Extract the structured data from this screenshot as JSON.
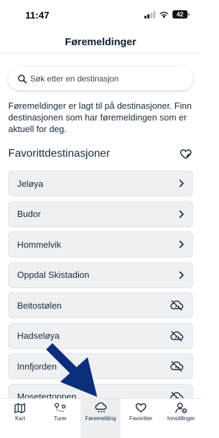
{
  "status_bar": {
    "time": "11:47",
    "battery": "42"
  },
  "header": {
    "title": "Føremeldinger"
  },
  "search": {
    "placeholder": "Søk etter en destinasjon"
  },
  "intro_text": "Føremeldinger er lagt til på destinasjoner. Finn destinasjonen som har føremeldingen som er aktuell for deg.",
  "favorites": {
    "title": "Favorittdestinasjoner",
    "items": [
      {
        "label": "Jeløya",
        "icon": "chevron-right-icon"
      },
      {
        "label": "Budor",
        "icon": "chevron-right-icon"
      },
      {
        "label": "Hommelvik",
        "icon": "chevron-right-icon"
      },
      {
        "label": "Oppdal Skistadion",
        "icon": "chevron-right-icon"
      },
      {
        "label": "Beitostølen",
        "icon": "cloud-off-icon"
      },
      {
        "label": "Hadseløya",
        "icon": "cloud-off-icon"
      },
      {
        "label": "Innfjorden",
        "icon": "cloud-off-icon"
      },
      {
        "label": "Mosetertoppen",
        "icon": "cloud-off-icon"
      }
    ]
  },
  "tabs": [
    {
      "label": "Kart",
      "icon": "map-icon",
      "active": false
    },
    {
      "label": "Turer",
      "icon": "route-icon",
      "active": false
    },
    {
      "label": "Føremelding",
      "icon": "snow-cloud-icon",
      "active": true
    },
    {
      "label": "Favoritter",
      "icon": "heart-icon",
      "active": false
    },
    {
      "label": "Innstillinger",
      "icon": "user-settings-icon",
      "active": false
    }
  ],
  "colors": {
    "text": "#1b2b3d",
    "item_bg": "#eef0f2",
    "arrow": "#0b2f7a"
  }
}
